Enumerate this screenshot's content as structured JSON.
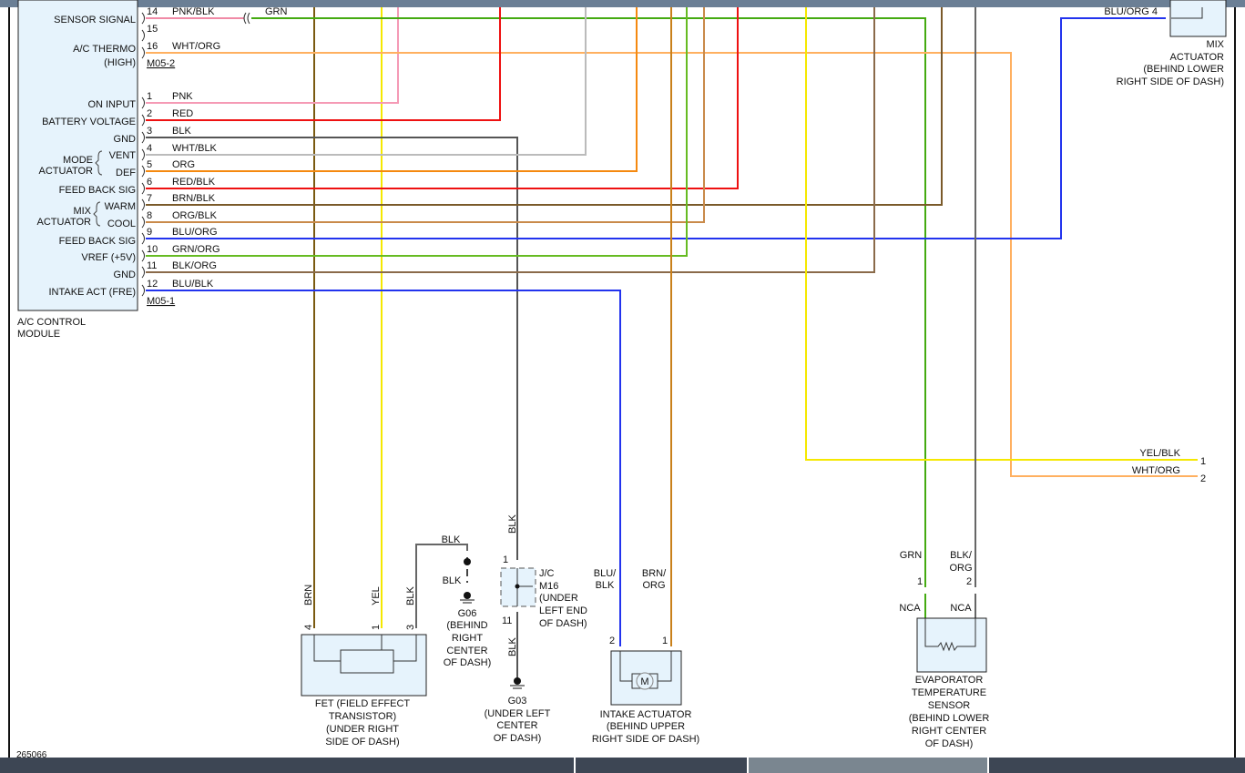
{
  "module": {
    "name_line1": "A/C CONTROL",
    "name_line2": "MODULE",
    "connector_upper": "M05-2",
    "connector_lower": "M05-1",
    "labels": {
      "sensor_signal": "SENSOR SIGNAL",
      "ac_thermo": "A/C THERMO",
      "ac_thermo_high": "(HIGH)",
      "on_input": "ON INPUT",
      "battery_voltage": "BATTERY VOLTAGE",
      "gnd1": "GND",
      "mode": "MODE",
      "actuator1": "ACTUATOR",
      "vent": "VENT",
      "def": "DEF",
      "feedback1": "FEED BACK SIG",
      "mix": "MIX",
      "actuator2": "ACTUATOR",
      "warm": "WARM",
      "cool": "COOL",
      "feedback2": "FEED BACK SIG",
      "vref": "VREF (+5V)",
      "gnd2": "GND",
      "intake_act": "INTAKE ACT (FRE)"
    },
    "pins": [
      {
        "pin": "14",
        "wire": "PNK/BLK",
        "color": "#f08aa6"
      },
      {
        "pin": "15",
        "wire": "",
        "color": ""
      },
      {
        "pin": "16",
        "wire": "WHT/ORG",
        "color": "#ffb060"
      },
      {
        "pin": "1",
        "wire": "PNK",
        "color": "#f59ab5"
      },
      {
        "pin": "2",
        "wire": "RED",
        "color": "#ee1111"
      },
      {
        "pin": "3",
        "wire": "BLK",
        "color": "#555555"
      },
      {
        "pin": "4",
        "wire": "WHT/BLK",
        "color": "#bbbbbb"
      },
      {
        "pin": "5",
        "wire": "ORG",
        "color": "#f5890f"
      },
      {
        "pin": "6",
        "wire": "RED/BLK",
        "color": "#ee1111"
      },
      {
        "pin": "7",
        "wire": "BRN/BLK",
        "color": "#7a5a2a"
      },
      {
        "pin": "8",
        "wire": "ORG/BLK",
        "color": "#c98a4a"
      },
      {
        "pin": "9",
        "wire": "BLU/ORG",
        "color": "#2233ee"
      },
      {
        "pin": "10",
        "wire": "GRN/ORG",
        "color": "#55bb22"
      },
      {
        "pin": "11",
        "wire": "BLK/ORG",
        "color": "#8a6a4a"
      },
      {
        "pin": "12",
        "wire": "BLU/BLK",
        "color": "#2233ee"
      }
    ]
  },
  "wires": {
    "grn": "GRN",
    "blu_org_4": "BLU/ORG 4",
    "yel_blk": "YEL/BLK",
    "yel_blk_pin": "1",
    "wht_org": "WHT/ORG",
    "wht_org_pin": "2",
    "brn": "BRN",
    "yel": "YEL",
    "blk": "BLK",
    "blu_blk_1": "BLU/",
    "blu_blk_2": "BLK",
    "brn_org_1": "BRN/",
    "brn_org_2": "ORG",
    "blk_org_1": "BLK/",
    "blk_org_2": "ORG"
  },
  "mix_actuator": {
    "l1": "MIX",
    "l2": "ACTUATOR",
    "l3": "(BEHIND LOWER",
    "l4": "RIGHT SIDE OF DASH)"
  },
  "fet": {
    "pins": [
      "4",
      "1",
      "3"
    ],
    "l1": "FET (FIELD EFFECT",
    "l2": "TRANSISTOR)",
    "l3": "(UNDER RIGHT",
    "l4": "SIDE OF DASH)"
  },
  "g06": {
    "l1": "G06",
    "l2": "(BEHIND",
    "l3": "RIGHT",
    "l4": "CENTER",
    "l5": "OF DASH)"
  },
  "jc": {
    "pin_top": "1",
    "pin_bottom": "11",
    "l1": "J/C",
    "l2": "M16",
    "l3": "(UNDER",
    "l4": "LEFT END",
    "l5": "OF DASH)"
  },
  "g03": {
    "l1": "G03",
    "l2": "(UNDER LEFT",
    "l3": "CENTER",
    "l4": "OF DASH)"
  },
  "intake": {
    "pins": [
      "2",
      "1"
    ],
    "motor": "M",
    "l1": "INTAKE ACTUATOR",
    "l2": "(BEHIND UPPER",
    "l3": "RIGHT SIDE OF DASH)"
  },
  "evap": {
    "pins": [
      "1",
      "2"
    ],
    "nca": "NCA",
    "l1": "EVAPORATOR",
    "l2": "TEMPERATURE",
    "l3": "SENSOR",
    "l4": "(BEHIND LOWER",
    "l5": "RIGHT CENTER",
    "l6": "OF DASH)"
  },
  "diagram_id": "265066"
}
